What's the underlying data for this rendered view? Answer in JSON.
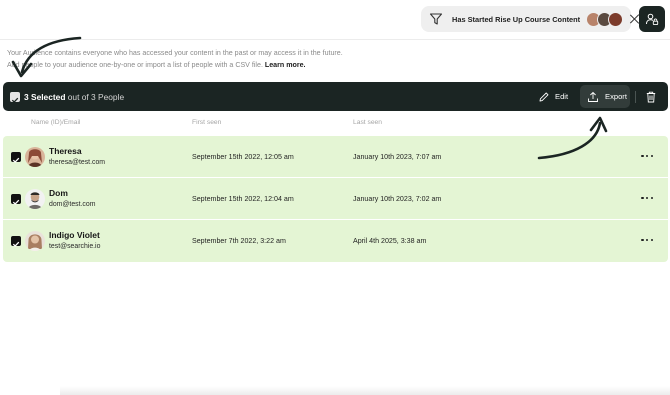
{
  "filter": {
    "label": "Has Started Rise Up Course Content",
    "icon": "filter-icon",
    "avatars": [
      "#b8836a",
      "#5a4a40",
      "#7c3b2b"
    ]
  },
  "user_button_icon": "user-lock-icon",
  "description": {
    "line1": "Your Audience contains everyone who has accessed your content in the past or may access it in the future.",
    "line2": "Add people to your audience one-by-one or import a list of people with a CSV file.",
    "link": "Learn more."
  },
  "selection": {
    "count_text": "3 Selected",
    "total_text": "out of 3 People",
    "edit_label": "Edit",
    "export_label": "Export"
  },
  "table": {
    "columns": [
      "Name (ID)/Email",
      "First seen",
      "Last seen"
    ],
    "rows": [
      {
        "name": "Theresa",
        "email": "theresa@test.com",
        "first_seen": "September 15th 2022, 12:05 am",
        "last_seen": "January 10th 2023, 7:07 am",
        "checked": true,
        "avatar_color": "#8c4a36"
      },
      {
        "name": "Dom",
        "email": "dom@test.com",
        "first_seen": "September 15th 2022, 12:04 am",
        "last_seen": "January 10th 2023, 7:02 am",
        "checked": true,
        "avatar_color": "#3e3a36"
      },
      {
        "name": "Indigo Violet",
        "email": "test@searchie.io",
        "first_seen": "September 7th 2022, 3:22 am",
        "last_seen": "April 4th 2025, 3:38 am",
        "checked": true,
        "avatar_color": "#a87e62"
      }
    ]
  },
  "colors": {
    "dark": "#1b2523",
    "row_bg": "#e4f5d4",
    "pill_bg": "#efefef"
  }
}
